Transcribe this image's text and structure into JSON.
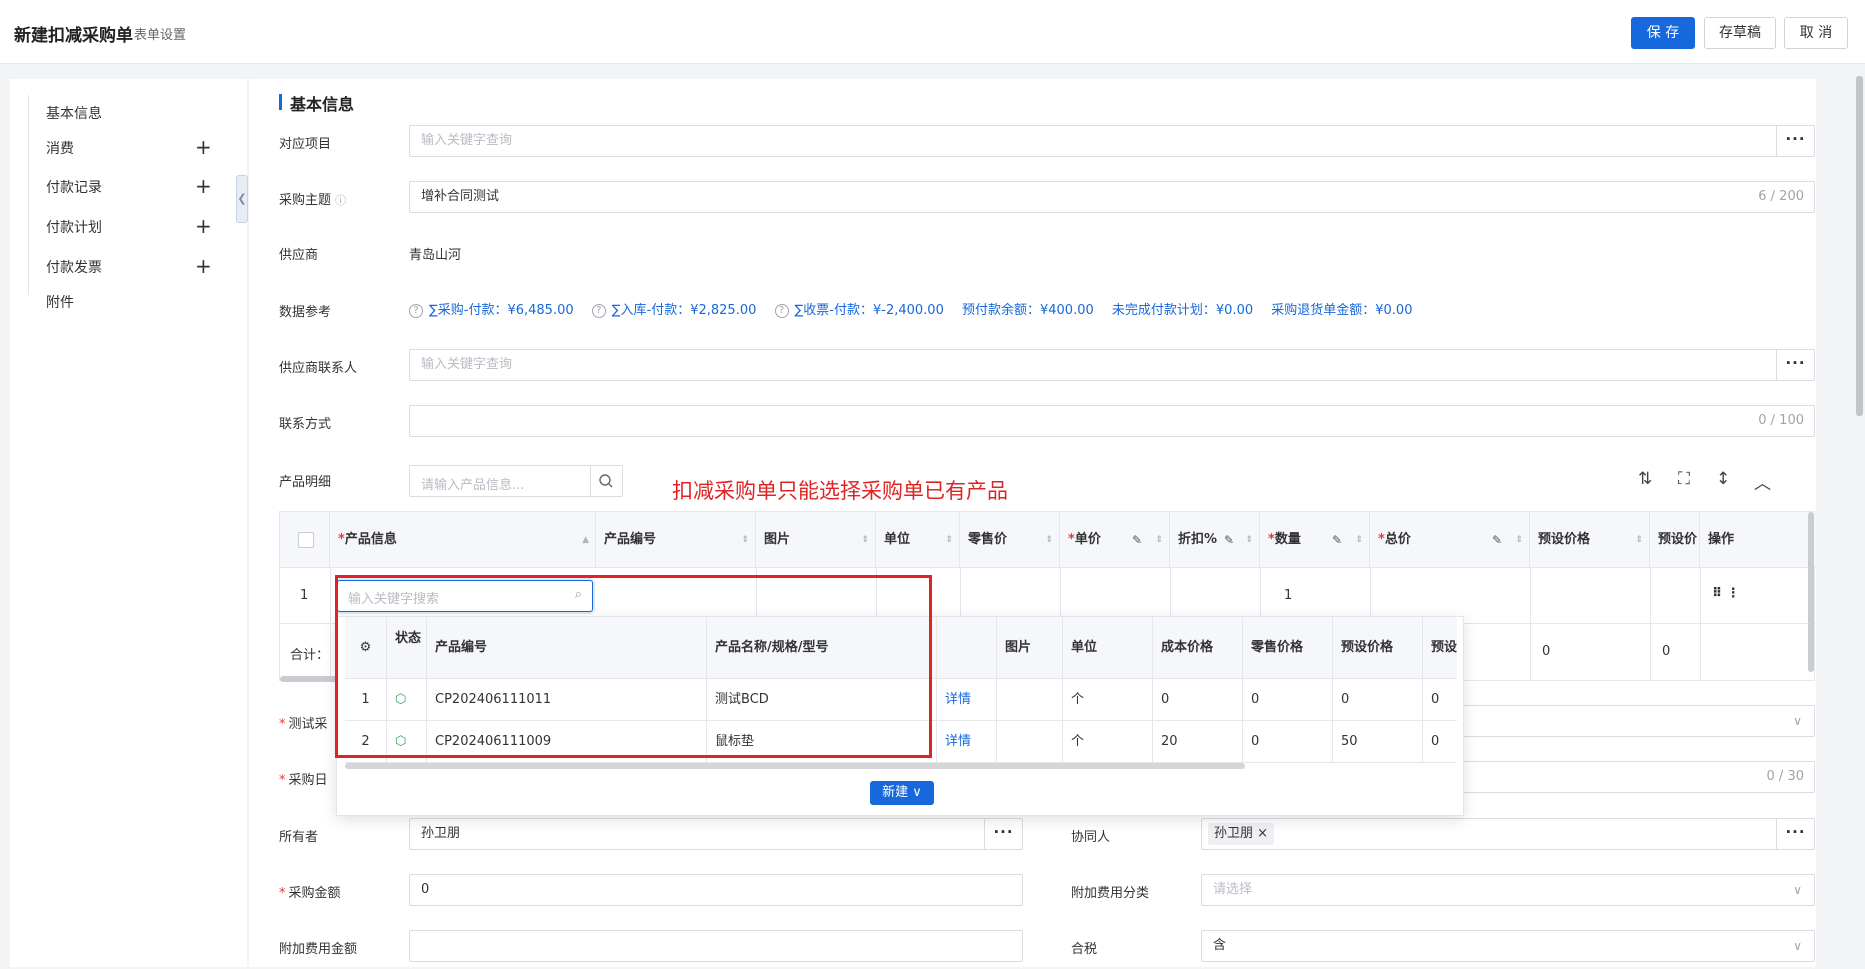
{
  "header": {
    "title": "新建扣减采购单",
    "subtitle": "表单设置",
    "save": "保 存",
    "draft": "存草稿",
    "cancel": "取 消"
  },
  "sidebar": {
    "items": [
      {
        "label": "基本信息",
        "plus": ""
      },
      {
        "label": "消费",
        "plus": "+"
      },
      {
        "label": "付款记录",
        "plus": "+"
      },
      {
        "label": "付款计划",
        "plus": "+"
      },
      {
        "label": "付款发票",
        "plus": "+"
      },
      {
        "label": "附件",
        "plus": ""
      }
    ]
  },
  "form": {
    "section_title": "基本信息",
    "project_label": "对应项目",
    "project_placeholder": "输入关键字查询",
    "subject_label": "采购主题",
    "subject_value": "增补合同测试",
    "subject_count": "6 / 200",
    "supplier_label": "供应商",
    "supplier_value": "青岛山河",
    "ref_label": "数据参考",
    "ref_items": [
      "∑采购-付款：¥6,485.00",
      "∑入库-付款：¥2,825.00",
      "∑收票-付款：¥-2,400.00",
      "预付款余额：¥400.00",
      "未完成付款计划：¥0.00",
      "采购退货单金额：¥0.00"
    ],
    "contact_label": "供应商联系人",
    "contact_placeholder": "输入关键字查询",
    "phone_label": "联系方式",
    "phone_count": "0 / 100",
    "product_label": "产品明细",
    "product_search_placeholder": "请输入产品信息...",
    "annotation": "扣减采购单只能选择采购单已有产品",
    "test_label": "测试采",
    "date_label": "采购日",
    "date_count": "0 / 30",
    "owner_label": "所有者",
    "owner_value": "孙卫朋",
    "collab_label": "协同人",
    "collab_tag": "孙卫朋 ×",
    "amount_label": "采购金额",
    "amount_value": "0",
    "extra_cat_label": "附加费用分类",
    "extra_cat_placeholder": "请选择",
    "extra_amount_label": "附加费用金额",
    "tax_label": "合税",
    "tax_value": "含"
  },
  "product_table": {
    "columns": [
      "产品信息",
      "产品编号",
      "图片",
      "单位",
      "零售价",
      "单价",
      "折扣%",
      "数量",
      "总价",
      "预设价格",
      "预设价",
      "操作"
    ],
    "row_index": "1",
    "row_qty": "1",
    "row_ops": "⠿ ⋮",
    "total_label": "合计：",
    "total_preset1": "0",
    "total_preset2": "0",
    "search_placeholder": "输入关键字搜索"
  },
  "popup": {
    "columns": [
      "状态",
      "产品编号",
      "产品名称/规格/型号",
      "",
      "图片",
      "单位",
      "成本价格",
      "零售价格",
      "预设价格",
      "预设"
    ],
    "rows": [
      {
        "idx": "1",
        "code": "CP202406111011",
        "name": "测试BCD",
        "link": "详情",
        "unit": "个",
        "cost": "0",
        "retail": "0",
        "preset": "0",
        "preset2": "0"
      },
      {
        "idx": "2",
        "code": "CP202406111009",
        "name": "鼠标垫",
        "link": "详情",
        "unit": "个",
        "cost": "20",
        "retail": "0",
        "preset": "50",
        "preset2": "0"
      }
    ],
    "new_button": "新建 ∨"
  }
}
